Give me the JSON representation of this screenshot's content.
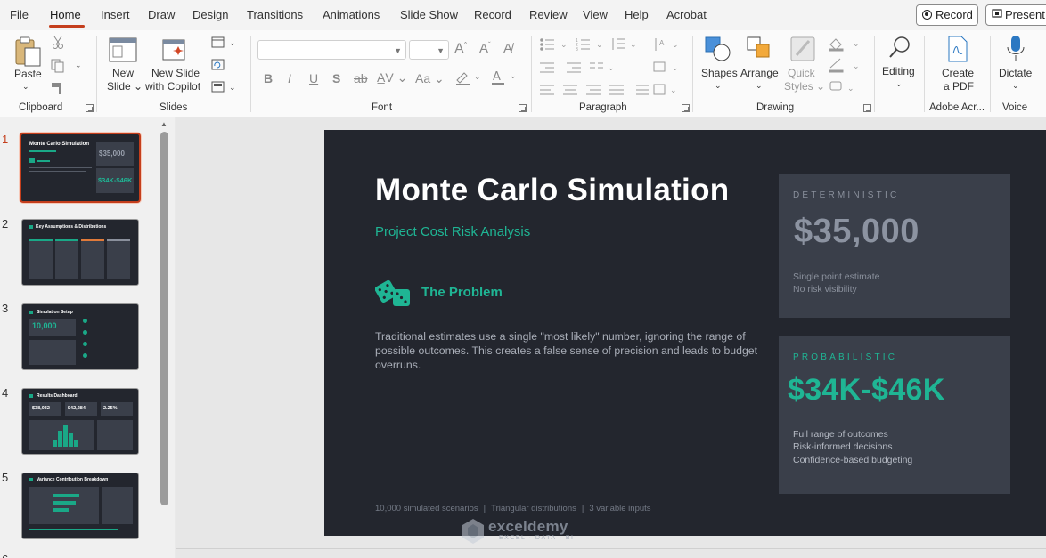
{
  "menu": {
    "items": [
      "File",
      "Home",
      "Insert",
      "Draw",
      "Design",
      "Transitions",
      "Animations",
      "Slide Show",
      "Record",
      "Review",
      "View",
      "Help",
      "Acrobat"
    ],
    "active": "Home",
    "record_label": "Record",
    "present_label": "Present"
  },
  "ribbon": {
    "clipboard": {
      "paste_label": "Paste",
      "group_label": "Clipboard"
    },
    "slides": {
      "new_slide_line1": "New",
      "new_slide_line2": "Slide",
      "copilot_line1": "New Slide",
      "copilot_line2": "with Copilot",
      "group_label": "Slides"
    },
    "font": {
      "font_name": "",
      "font_size": "",
      "bold": "B",
      "italic": "I",
      "underline": "U",
      "shadow": "S",
      "strike": "ab",
      "case": "Aa",
      "group_label": "Font"
    },
    "paragraph": {
      "group_label": "Paragraph"
    },
    "drawing": {
      "shapes_label": "Shapes",
      "arrange_label": "Arrange",
      "quick_styles_line1": "Quick",
      "quick_styles_line2": "Styles",
      "group_label": "Drawing"
    },
    "editing": {
      "label": "Editing"
    },
    "adobe": {
      "line1": "Create",
      "line2": "a PDF",
      "group_label": "Adobe Acr..."
    },
    "voice": {
      "dictate_label": "Dictate",
      "group_label": "Voice"
    }
  },
  "thumbnails": {
    "numbers": [
      "1",
      "2",
      "3",
      "4",
      "5",
      "6"
    ],
    "active_index": 1,
    "slide1": {
      "title": "Monte Carlo Simulation",
      "value": "$35,000",
      "range": "$34K-$46K"
    },
    "slide2": {
      "title": "Key Assumptions & Distributions"
    },
    "slide3": {
      "title": "Simulation Setup",
      "value": "10,000"
    },
    "slide4": {
      "title": "Results Dashboard",
      "v1": "$38,032",
      "v2": "$42,284",
      "v3": "2.25%"
    },
    "slide5": {
      "title": "Variance Contribution Breakdown"
    }
  },
  "slide": {
    "title": "Monte Carlo Simulation",
    "subtitle": "Project Cost Risk Analysis",
    "problem_heading": "The Problem",
    "problem_text": "Traditional estimates use a single \"most likely\" number, ignoring the range of possible outcomes. This creates a false sense of precision and leads to budget overruns.",
    "deterministic": {
      "label": "DETERMINISTIC",
      "value": "$35,000",
      "notes": [
        "Single point estimate",
        "No risk visibility"
      ]
    },
    "probabilistic": {
      "label": "PROBABILISTIC",
      "value": "$34K-$46K",
      "notes": [
        "Full range of outcomes",
        "Risk-informed decisions",
        "Confidence-based budgeting"
      ]
    },
    "footer": [
      "10,000 simulated scenarios",
      "Triangular distributions",
      "3 variable inputs"
    ],
    "colors": {
      "background": "#23262e",
      "accent": "#1fb594",
      "card": "#3a3f4a"
    }
  },
  "watermark": {
    "name": "exceldemy",
    "tagline": "EXCEL · DATA · BI"
  }
}
